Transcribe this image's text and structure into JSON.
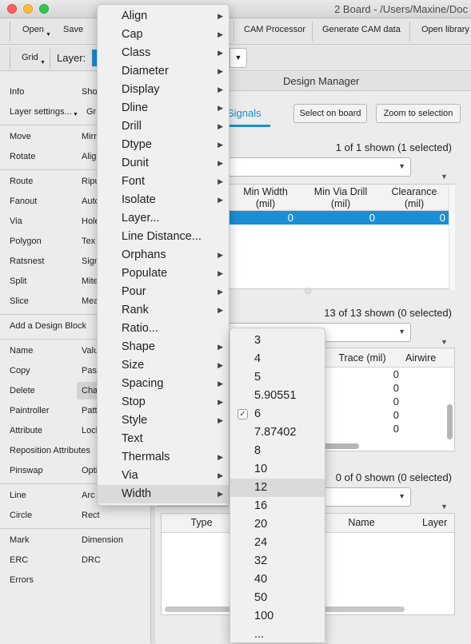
{
  "window": {
    "title": "2 Board - /Users/Maxine/Doc"
  },
  "toolbar": {
    "open_label": "Open",
    "save_label": "Save",
    "cam_processor_label": "CAM Processor",
    "generate_cam_label": "Generate CAM data",
    "open_library_label": "Open library",
    "grid_label": "Grid",
    "layer_label": "Layer:"
  },
  "commands": {
    "info": "Info",
    "show": "Sho",
    "layer_settings": "Layer settings...",
    "group": "Gr",
    "move": "Move",
    "mirror": "Mirr",
    "rotate": "Rotate",
    "align": "Alig",
    "route": "Route",
    "ripup": "Ripu",
    "fanout": "Fanout",
    "auto": "Auto",
    "via": "Via",
    "hole": "Hole",
    "polygon": "Polygon",
    "text": "Tex",
    "ratsnest": "Ratsnest",
    "signal": "Sign",
    "split": "Split",
    "miter": "Mite",
    "slice": "Slice",
    "meander": "Mea",
    "add_design_block": "Add a Design Block",
    "name": "Name",
    "value": "Valu",
    "copy": "Copy",
    "paste": "Past",
    "delete": "Delete",
    "change": "Cha",
    "paintroller": "Paintroller",
    "pattern": "Patte",
    "attribute": "Attribute",
    "lock": "Lock",
    "reposition_attributes": "Reposition Attributes",
    "pinswap": "Pinswap",
    "optimize": "Opti",
    "line": "Line",
    "arc": "Arc",
    "circle": "Circle",
    "rect": "Rect",
    "mark": "Mark",
    "dimension": "Dimension",
    "erc": "ERC",
    "drc": "DRC",
    "errors": "Errors"
  },
  "design_manager": {
    "title": "Design Manager",
    "tab_signals": "Signals",
    "select_on_board": "Select on board",
    "zoom_to_selection": "Zoom to selection",
    "classes": {
      "count": "1 of 1 shown (1 selected)",
      "headers": {
        "min_width": "Min Width\n(mil)",
        "min_via_drill": "Min Via Drill\n(mil)",
        "clearance": "Clearance\n(mil)"
      },
      "row": {
        "min_width": "0",
        "min_via_drill": "0",
        "clearance": "0"
      }
    },
    "signals": {
      "count": "13 of 13 shown (0 selected)",
      "headers": {
        "trace": "Trace (mil)",
        "airwire": "Airwire"
      },
      "trace_values": [
        "0",
        "0",
        "0",
        "0",
        "0"
      ]
    },
    "errors": {
      "count": "0 of 0 shown (0 selected)",
      "headers": {
        "type": "Type",
        "name": "Name",
        "layer": "Layer"
      }
    }
  },
  "menu": {
    "items": [
      {
        "label": "Align",
        "submenu": true
      },
      {
        "label": "Cap",
        "submenu": true
      },
      {
        "label": "Class",
        "submenu": true
      },
      {
        "label": "Diameter",
        "submenu": true
      },
      {
        "label": "Display",
        "submenu": true
      },
      {
        "label": "Dline",
        "submenu": true
      },
      {
        "label": "Drill",
        "submenu": true
      },
      {
        "label": "Dtype",
        "submenu": true
      },
      {
        "label": "Dunit",
        "submenu": true
      },
      {
        "label": "Font",
        "submenu": true
      },
      {
        "label": "Isolate",
        "submenu": true
      },
      {
        "label": "Layer...",
        "submenu": false
      },
      {
        "label": "Line Distance...",
        "submenu": false
      },
      {
        "label": "Orphans",
        "submenu": true
      },
      {
        "label": "Populate",
        "submenu": true
      },
      {
        "label": "Pour",
        "submenu": true
      },
      {
        "label": "Rank",
        "submenu": true
      },
      {
        "label": "Ratio...",
        "submenu": false
      },
      {
        "label": "Shape",
        "submenu": true
      },
      {
        "label": "Size",
        "submenu": true
      },
      {
        "label": "Spacing",
        "submenu": true
      },
      {
        "label": "Stop",
        "submenu": true
      },
      {
        "label": "Style",
        "submenu": true
      },
      {
        "label": "Text",
        "submenu": false
      },
      {
        "label": "Thermals",
        "submenu": true
      },
      {
        "label": "Via",
        "submenu": true
      },
      {
        "label": "Width",
        "submenu": true
      }
    ]
  },
  "width_submenu": {
    "items": [
      "3",
      "4",
      "5",
      "5.90551",
      "6",
      "7.87402",
      "8",
      "10",
      "12",
      "16",
      "20",
      "24",
      "32",
      "40",
      "50",
      "100",
      "..."
    ],
    "checked": "6",
    "highlighted": "12"
  },
  "colors": {
    "selection": "#1a8fd6",
    "menu_highlight": "#dadada",
    "tab_accent": "#1a8fd6"
  }
}
